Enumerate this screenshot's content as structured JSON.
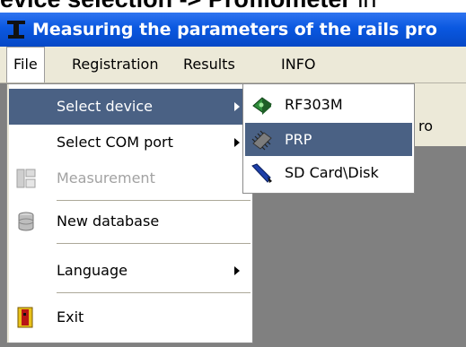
{
  "heading": {
    "bold": "evice selection -> Profilometer",
    "tail": " in"
  },
  "window": {
    "title": "Measuring the parameters of the rails pro"
  },
  "menubar": {
    "file": "File",
    "registration": "Registration",
    "results": "Results",
    "info": "INFO"
  },
  "file_menu": {
    "select_device": "Select device",
    "select_com_port": "Select COM port",
    "measurement": "Measurement",
    "new_database": "New database",
    "language": "Language",
    "exit": "Exit"
  },
  "device_submenu": {
    "items": [
      "RF303M",
      "PRP",
      "SD Card\\Disk"
    ],
    "selected": "PRP"
  },
  "background_fragment": "ro",
  "colors": {
    "highlight": "#4a6184",
    "titlebar": "#0a58e0",
    "menu_bg": "#ece9d8",
    "workspace": "#808080"
  },
  "icons": [
    "app-icon",
    "measurement-icon",
    "database-icon",
    "exit-icon",
    "rf303m-device-icon",
    "prp-chip-icon",
    "sd-card-icon"
  ]
}
